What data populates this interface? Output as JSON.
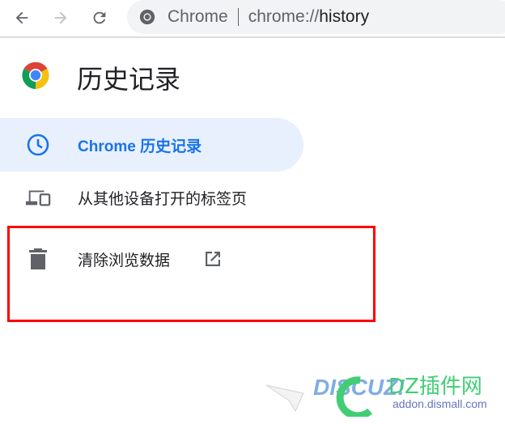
{
  "toolbar": {
    "back_icon": "arrow-left-icon",
    "forward_icon": "arrow-right-icon",
    "reload_icon": "reload-icon",
    "site_name": "Chrome",
    "url_prefix": "chrome://",
    "url_path": "history"
  },
  "page": {
    "title": "历史记录"
  },
  "sidebar": {
    "items": [
      {
        "label": "Chrome 历史记录",
        "icon": "clock-icon",
        "active": true
      },
      {
        "label": "从其他设备打开的标签页",
        "icon": "devices-icon"
      },
      {
        "label": "清除浏览数据",
        "icon": "trash-icon",
        "trailing_icon": "open-in-new-icon"
      }
    ]
  },
  "watermark": {
    "text": "DISCUZ! DZ插件网",
    "url": "addon.dismall.com"
  },
  "colors": {
    "accent": "#1a73e8",
    "active_bg": "#e8f0fe",
    "highlight": "#ff0000"
  }
}
